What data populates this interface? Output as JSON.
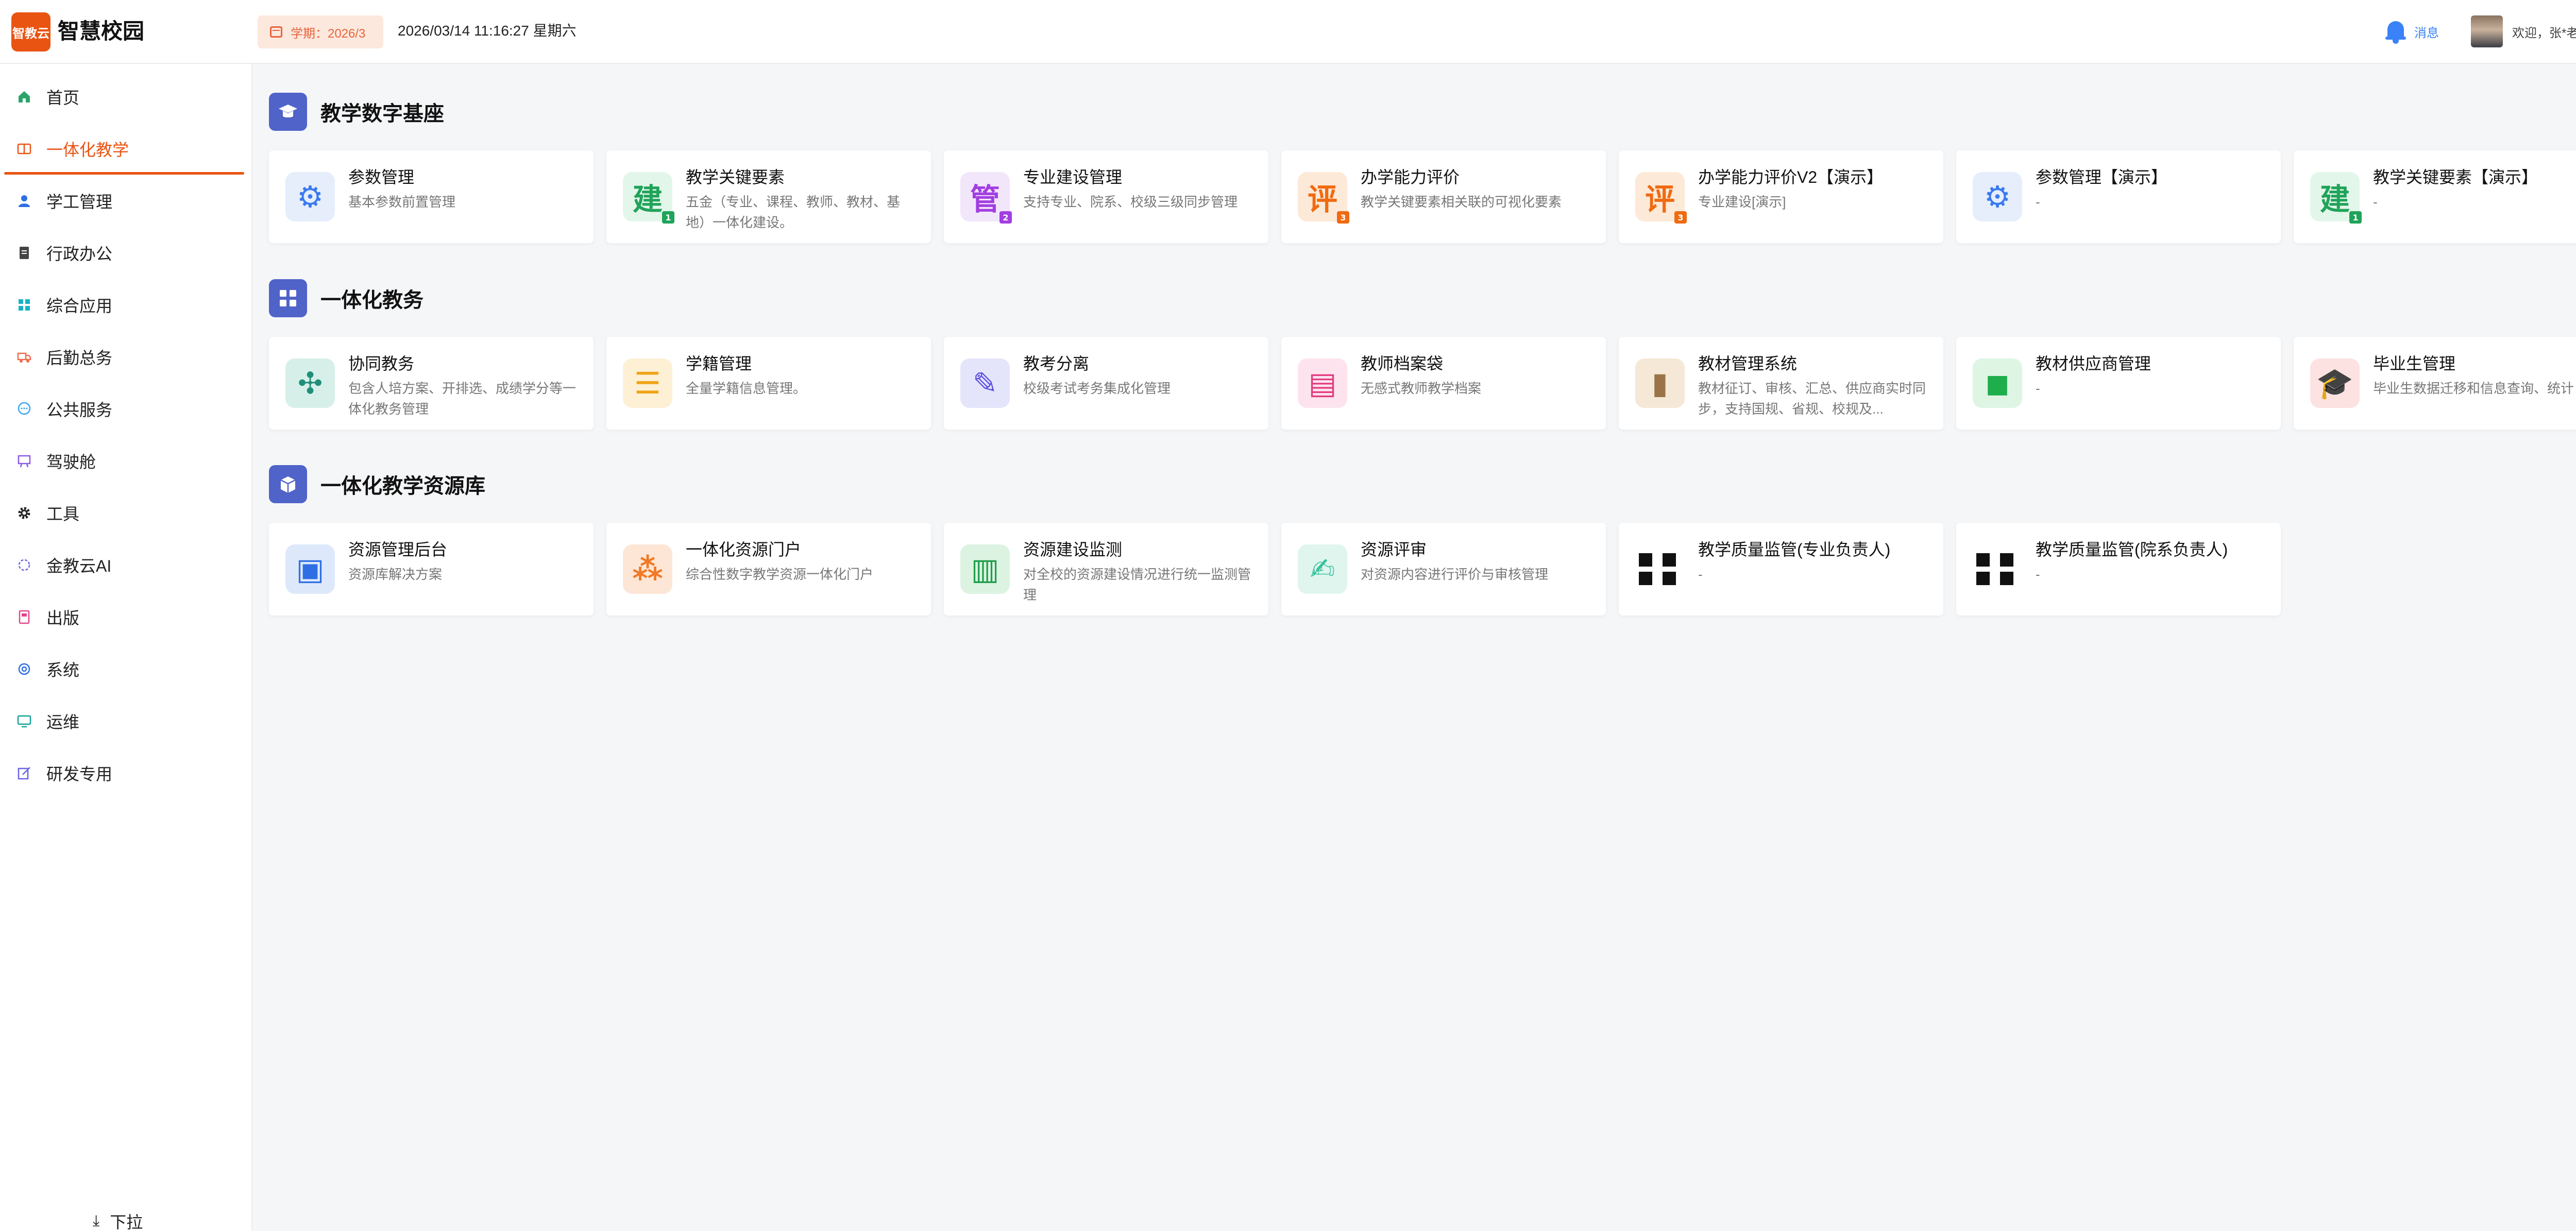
{
  "header": {
    "logo_text": "智教云",
    "app_title": "智慧校园",
    "term_label": "学期：2026/3",
    "datetime": "2026/03/14 11:16:27 星期六",
    "messages_label": "消息",
    "welcome": "欢迎，张*老师"
  },
  "sidebar": {
    "items": [
      {
        "label": "首页",
        "icon": "home-icon"
      },
      {
        "label": "一体化教学",
        "icon": "book-icon",
        "active": true
      },
      {
        "label": "学工管理",
        "icon": "user-icon"
      },
      {
        "label": "行政办公",
        "icon": "document-icon"
      },
      {
        "label": "综合应用",
        "icon": "apps-icon"
      },
      {
        "label": "后勤总务",
        "icon": "truck-icon"
      },
      {
        "label": "公共服务",
        "icon": "chat-icon"
      },
      {
        "label": "驾驶舱",
        "icon": "dashboard-icon"
      },
      {
        "label": "工具",
        "icon": "gear-icon"
      },
      {
        "label": "金教云AI",
        "icon": "ai-icon"
      },
      {
        "label": "出版",
        "icon": "publish-icon"
      },
      {
        "label": "系统",
        "icon": "settings-icon"
      },
      {
        "label": "运维",
        "icon": "monitor-icon"
      },
      {
        "label": "研发专用",
        "icon": "edit-icon"
      }
    ],
    "pull_down": "下拉"
  },
  "sections": [
    {
      "title": "教学数字基座",
      "icon": "graduation-cap-icon",
      "cards": [
        {
          "title": "参数管理",
          "desc": "基本参数前置管理",
          "icon": "gear-icon",
          "bg": "#e6eefc",
          "fg": "#3a7af0",
          "glyph": "⚙",
          "sub": ""
        },
        {
          "title": "教学关键要素",
          "desc": "五金（专业、课程、教师、教材、基地）一体化建设。",
          "icon": "build-icon",
          "bg": "#e3f6ea",
          "fg": "#20a35a",
          "glyph": "建",
          "sub": "1"
        },
        {
          "title": "专业建设管理",
          "desc": "支持专业、院系、校级三级同步管理",
          "icon": "manage-icon",
          "bg": "#f2e6fb",
          "fg": "#a23ee0",
          "glyph": "管",
          "sub": "2"
        },
        {
          "title": "办学能力评价",
          "desc": "教学关键要素相关联的可视化要素",
          "icon": "evaluate-icon",
          "bg": "#fde9d8",
          "fg": "#f06a10",
          "glyph": "评",
          "sub": "3"
        },
        {
          "title": "办学能力评价V2【演示】",
          "desc": "专业建设[演示]",
          "icon": "evaluate-icon",
          "bg": "#fde9d8",
          "fg": "#f06a10",
          "glyph": "评",
          "sub": "3"
        },
        {
          "title": "参数管理【演示】",
          "desc": "-",
          "icon": "gear-icon",
          "bg": "#e6eefc",
          "fg": "#3a7af0",
          "glyph": "⚙",
          "sub": ""
        },
        {
          "title": "教学关键要素【演示】",
          "desc": "-",
          "icon": "build-icon",
          "bg": "#e3f6ea",
          "fg": "#20a35a",
          "glyph": "建",
          "sub": "1"
        }
      ]
    },
    {
      "title": "一体化教务",
      "icon": "grid-icon",
      "cards": [
        {
          "title": "协同教务",
          "desc": "包含人培方案、开排选、成绩学分等一体化教务管理",
          "icon": "share-icon",
          "bg": "#d7efe9",
          "fg": "#1f8f7a",
          "glyph": "✣",
          "sub": ""
        },
        {
          "title": "学籍管理",
          "desc": "全量学籍信息管理。",
          "icon": "books-icon",
          "bg": "#fdf0d4",
          "fg": "#f0a316",
          "glyph": "☰",
          "sub": ""
        },
        {
          "title": "教考分离",
          "desc": "校级考试考务集成化管理",
          "icon": "pen-icon",
          "bg": "#e4e4fb",
          "fg": "#5a4ee0",
          "glyph": "✎",
          "sub": ""
        },
        {
          "title": "教师档案袋",
          "desc": "无感式教师教学档案",
          "icon": "folder-icon",
          "bg": "#fde3ee",
          "fg": "#e33a7f",
          "glyph": "▤",
          "sub": ""
        },
        {
          "title": "教材管理系统",
          "desc": "教材征订、审核、汇总、供应商实时同步，支持国规、省规、校规及...",
          "icon": "textbook-icon",
          "bg": "#f5e8d6",
          "fg": "#9a7448",
          "glyph": "▮",
          "sub": ""
        },
        {
          "title": "教材供应商管理",
          "desc": "-",
          "icon": "shopping-bag-icon",
          "bg": "#def5e4",
          "fg": "#1fae4c",
          "glyph": "◼",
          "sub": ""
        },
        {
          "title": "毕业生管理",
          "desc": "毕业生数据迁移和信息查询、统计",
          "icon": "graduation-cap-icon",
          "bg": "#fde2e2",
          "fg": "#e02d2d",
          "glyph": "🎓",
          "sub": ""
        }
      ]
    },
    {
      "title": "一体化教学资源库",
      "icon": "box-icon",
      "cards": [
        {
          "title": "资源管理后台",
          "desc": "资源库解决方案",
          "icon": "id-card-icon",
          "bg": "#dde9fb",
          "fg": "#2f6fe4",
          "glyph": "▣",
          "sub": ""
        },
        {
          "title": "一体化资源门户",
          "desc": "综合性数字教学资源一体化门户",
          "icon": "network-icon",
          "bg": "#fde6d6",
          "fg": "#f07a26",
          "glyph": "⁂",
          "sub": ""
        },
        {
          "title": "资源建设监测",
          "desc": "对全校的资源建设情况进行统一监测管理",
          "icon": "chart-icon",
          "bg": "#dcf3e2",
          "fg": "#1f9e4a",
          "glyph": "▥",
          "sub": ""
        },
        {
          "title": "资源评审",
          "desc": "对资源内容进行评价与审核管理",
          "icon": "review-icon",
          "bg": "#dff5ee",
          "fg": "#35c29a",
          "glyph": "✍",
          "sub": ""
        },
        {
          "title": "教学质量监管(专业负责人)",
          "desc": "-",
          "icon": "grid-icon",
          "bg": "",
          "fg": "#111",
          "glyph": "grid",
          "sub": ""
        },
        {
          "title": "教学质量监管(院系负责人)",
          "desc": "-",
          "icon": "grid-icon",
          "bg": "",
          "fg": "#111",
          "glyph": "grid",
          "sub": ""
        }
      ]
    }
  ]
}
